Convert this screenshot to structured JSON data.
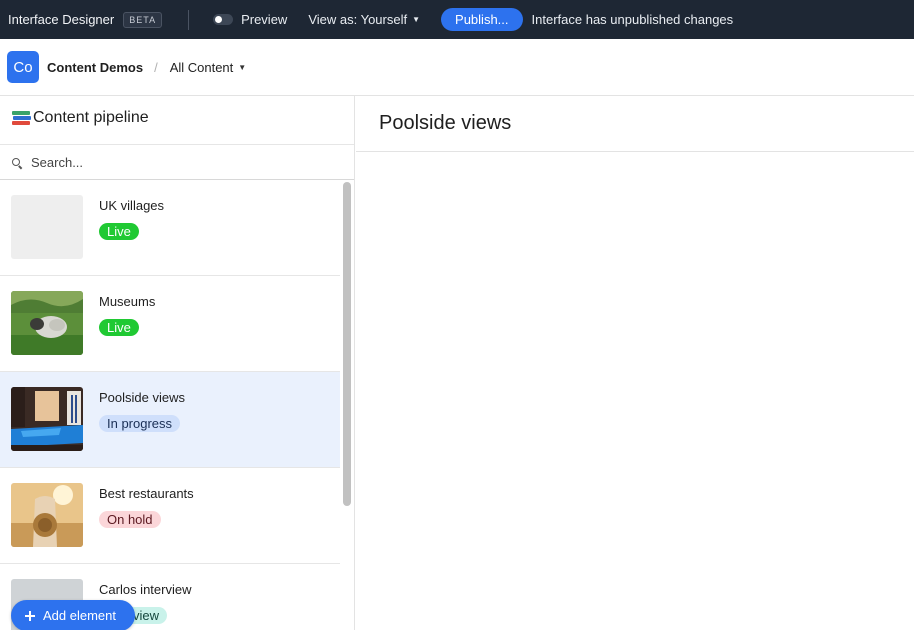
{
  "topbar": {
    "app_title": "Interface Designer",
    "beta_label": "BETA",
    "preview_label": "Preview",
    "view_as_label": "View as: Yourself",
    "publish_label": "Publish...",
    "status_text": "Interface has unpublished changes"
  },
  "header": {
    "workspace_initials": "Co",
    "workspace_name": "Content Demos",
    "separator": "/",
    "view_label": "All Content"
  },
  "sidebar": {
    "title": "Content pipeline",
    "search_placeholder": "Search...",
    "items": [
      {
        "title": "UK villages",
        "status": "Live",
        "status_type": "live",
        "thumb": "blank"
      },
      {
        "title": "Museums",
        "status": "Live",
        "status_type": "live",
        "thumb": "sheep-field"
      },
      {
        "title": "Poolside views",
        "status": "In progress",
        "status_type": "progress",
        "thumb": "pool",
        "selected": true
      },
      {
        "title": "Best restaurants",
        "status": "On hold",
        "status_type": "hold",
        "thumb": "sunset-hat"
      },
      {
        "title": "Carlos interview",
        "status": "In review",
        "status_type": "review",
        "thumb": "grey"
      }
    ]
  },
  "add_element_label": "Add element",
  "detail": {
    "title": "Poolside views"
  },
  "colors": {
    "topbar_bg": "#1e2734",
    "accent": "#2d72ee",
    "selected_row": "#eaf1fd",
    "live": "#20c933"
  }
}
